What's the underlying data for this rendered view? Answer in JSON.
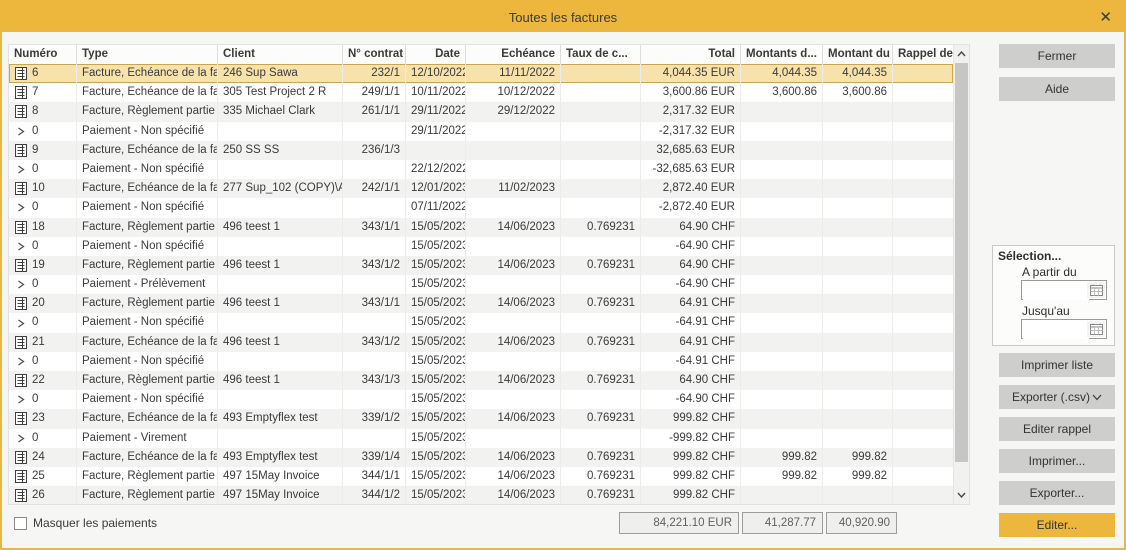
{
  "window": {
    "title": "Toutes les factures",
    "close_glyph": "✕"
  },
  "colors": {
    "accent": "#EDB73D",
    "selected_row": "#F7E2AC",
    "button_gray": "#CECECC"
  },
  "table": {
    "headers": [
      "Numéro",
      "Type",
      "Client",
      "N° contrat",
      "Date",
      "Echéance",
      "Taux de c...",
      "Total",
      "Montants d...",
      "Montant du",
      "Rappel de pai..."
    ],
    "rows": [
      {
        "icon": "invoice",
        "selected": true,
        "numero": "6",
        "type": "Facture, Echéance de la fa",
        "client": "246 Sup Sawa",
        "contrat": "232/1",
        "date": "12/10/2022",
        "echeance": "11/11/2022",
        "taux": "",
        "total": "4,044.35 EUR",
        "montants": "4,044.35",
        "montant_du": "4,044.35",
        "rappel": ""
      },
      {
        "icon": "invoice",
        "numero": "7",
        "type": "Facture, Echéance de la fa",
        "client": "305 Test Project 2 R",
        "contrat": "249/1/1",
        "date": "10/11/2022",
        "echeance": "10/12/2022",
        "taux": "",
        "total": "3,600.86 EUR",
        "montants": "3,600.86",
        "montant_du": "3,600.86",
        "rappel": ""
      },
      {
        "icon": "invoice",
        "numero": "8",
        "type": "Facture, Règlement partie",
        "client": "335 Michael Clark",
        "contrat": "261/1/1",
        "date": "29/11/2022",
        "echeance": "29/12/2022",
        "taux": "",
        "total": "2,317.32 EUR",
        "montants": "",
        "montant_du": "",
        "rappel": ""
      },
      {
        "icon": "payment",
        "numero": "0",
        "type": "Paiement - Non spécifié",
        "client": "",
        "contrat": "",
        "date": "29/11/2022",
        "echeance": "",
        "taux": "",
        "total": "-2,317.32 EUR",
        "montants": "",
        "montant_du": "",
        "rappel": ""
      },
      {
        "icon": "invoice",
        "numero": "9",
        "type": "Facture, Echéance de la fa",
        "client": "250 SS SS",
        "contrat": "236/1/3",
        "date": "",
        "echeance": "",
        "taux": "",
        "total": "32,685.63 EUR",
        "montants": "",
        "montant_du": "",
        "rappel": ""
      },
      {
        "icon": "payment",
        "numero": "0",
        "type": "Paiement - Non spécifié",
        "client": "",
        "contrat": "",
        "date": "22/12/2022",
        "echeance": "",
        "taux": "",
        "total": "-32,685.63 EUR",
        "montants": "",
        "montant_du": "",
        "rappel": ""
      },
      {
        "icon": "invoice",
        "numero": "10",
        "type": "Facture, Echéance de la fa",
        "client": "277 Sup_102 (COPY)\\A",
        "contrat": "242/1/1",
        "date": "12/01/2023",
        "echeance": "11/02/2023",
        "taux": "",
        "total": "2,872.40 EUR",
        "montants": "",
        "montant_du": "",
        "rappel": ""
      },
      {
        "icon": "payment",
        "numero": "0",
        "type": "Paiement - Non spécifié",
        "client": "",
        "contrat": "",
        "date": "07/11/2022",
        "echeance": "",
        "taux": "",
        "total": "-2,872.40 EUR",
        "montants": "",
        "montant_du": "",
        "rappel": ""
      },
      {
        "icon": "invoice",
        "numero": "18",
        "type": "Facture, Règlement partie",
        "client": "496 teest 1",
        "contrat": "343/1/1",
        "date": "15/05/2023",
        "echeance": "14/06/2023",
        "taux": "0.769231",
        "total": "64.90 CHF",
        "montants": "",
        "montant_du": "",
        "rappel": ""
      },
      {
        "icon": "payment",
        "numero": "0",
        "type": "Paiement - Non spécifié",
        "client": "",
        "contrat": "",
        "date": "15/05/2023",
        "echeance": "",
        "taux": "",
        "total": "-64.90 CHF",
        "montants": "",
        "montant_du": "",
        "rappel": ""
      },
      {
        "icon": "invoice",
        "numero": "19",
        "type": "Facture, Règlement partie",
        "client": "496 teest 1",
        "contrat": "343/1/2",
        "date": "15/05/2023",
        "echeance": "14/06/2023",
        "taux": "0.769231",
        "total": "64.90 CHF",
        "montants": "",
        "montant_du": "",
        "rappel": ""
      },
      {
        "icon": "payment",
        "numero": "0",
        "type": "Paiement - Prélèvement",
        "client": "",
        "contrat": "",
        "date": "15/05/2023",
        "echeance": "",
        "taux": "",
        "total": "-64.90 CHF",
        "montants": "",
        "montant_du": "",
        "rappel": ""
      },
      {
        "icon": "invoice",
        "numero": "20",
        "type": "Facture, Règlement partie",
        "client": "496 teest 1",
        "contrat": "343/1/1",
        "date": "15/05/2023",
        "echeance": "14/06/2023",
        "taux": "0.769231",
        "total": "64.91 CHF",
        "montants": "",
        "montant_du": "",
        "rappel": ""
      },
      {
        "icon": "payment",
        "numero": "0",
        "type": "Paiement - Non spécifié",
        "client": "",
        "contrat": "",
        "date": "15/05/2023",
        "echeance": "",
        "taux": "",
        "total": "-64.91 CHF",
        "montants": "",
        "montant_du": "",
        "rappel": ""
      },
      {
        "icon": "invoice",
        "numero": "21",
        "type": "Facture, Echéance de la fa",
        "client": "496 teest 1",
        "contrat": "343/1/2",
        "date": "15/05/2023",
        "echeance": "14/06/2023",
        "taux": "0.769231",
        "total": "64.91 CHF",
        "montants": "",
        "montant_du": "",
        "rappel": ""
      },
      {
        "icon": "payment",
        "numero": "0",
        "type": "Paiement - Non spécifié",
        "client": "",
        "contrat": "",
        "date": "15/05/2023",
        "echeance": "",
        "taux": "",
        "total": "-64.91 CHF",
        "montants": "",
        "montant_du": "",
        "rappel": ""
      },
      {
        "icon": "invoice",
        "numero": "22",
        "type": "Facture, Règlement partie",
        "client": "496 teest 1",
        "contrat": "343/1/3",
        "date": "15/05/2023",
        "echeance": "14/06/2023",
        "taux": "0.769231",
        "total": "64.90 CHF",
        "montants": "",
        "montant_du": "",
        "rappel": ""
      },
      {
        "icon": "payment",
        "numero": "0",
        "type": "Paiement - Non spécifié",
        "client": "",
        "contrat": "",
        "date": "15/05/2023",
        "echeance": "",
        "taux": "",
        "total": "-64.90 CHF",
        "montants": "",
        "montant_du": "",
        "rappel": ""
      },
      {
        "icon": "invoice",
        "numero": "23",
        "type": "Facture, Echéance de la fa",
        "client": "493 Emptyflex test",
        "contrat": "339/1/2",
        "date": "15/05/2023",
        "echeance": "14/06/2023",
        "taux": "0.769231",
        "total": "999.82 CHF",
        "montants": "",
        "montant_du": "",
        "rappel": ""
      },
      {
        "icon": "payment",
        "numero": "0",
        "type": "Paiement - Virement",
        "client": "",
        "contrat": "",
        "date": "15/05/2023",
        "echeance": "",
        "taux": "",
        "total": "-999.82 CHF",
        "montants": "",
        "montant_du": "",
        "rappel": ""
      },
      {
        "icon": "invoice",
        "numero": "24",
        "type": "Facture, Echéance de la fa",
        "client": "493 Emptyflex test",
        "contrat": "339/1/4",
        "date": "15/05/2023",
        "echeance": "14/06/2023",
        "taux": "0.769231",
        "total": "999.82 CHF",
        "montants": "999.82",
        "montant_du": "999.82",
        "rappel": ""
      },
      {
        "icon": "invoice",
        "numero": "25",
        "type": "Facture, Règlement partie",
        "client": "497 15May Invoice",
        "contrat": "344/1/1",
        "date": "15/05/2023",
        "echeance": "14/06/2023",
        "taux": "0.769231",
        "total": "999.82 CHF",
        "montants": "999.82",
        "montant_du": "999.82",
        "rappel": ""
      },
      {
        "icon": "invoice",
        "numero": "26",
        "type": "Facture, Règlement partie",
        "client": "497 15May Invoice",
        "contrat": "344/1/2",
        "date": "15/05/2023",
        "echeance": "14/06/2023",
        "taux": "0.769231",
        "total": "999.82 CHF",
        "montants": "",
        "montant_du": "",
        "rappel": ""
      }
    ]
  },
  "footer": {
    "hide_payments_label": "Masquer les paiements",
    "totals": {
      "total": "84,221.10 EUR",
      "montants": "41,287.77",
      "montant_du": "40,920.90"
    }
  },
  "sidebar": {
    "close_label": "Fermer",
    "help_label": "Aide",
    "selection": {
      "title": "Sélection...",
      "from_label": "A partir du",
      "to_label": "Jusqu'au",
      "from_value": "",
      "to_value": ""
    },
    "print_list_label": "Imprimer liste",
    "export_csv_label": "Exporter (.csv)",
    "edit_reminder_label": "Editer rappel",
    "print_label": "Imprimer...",
    "export_label": "Exporter...",
    "edit_label": "Editer..."
  }
}
